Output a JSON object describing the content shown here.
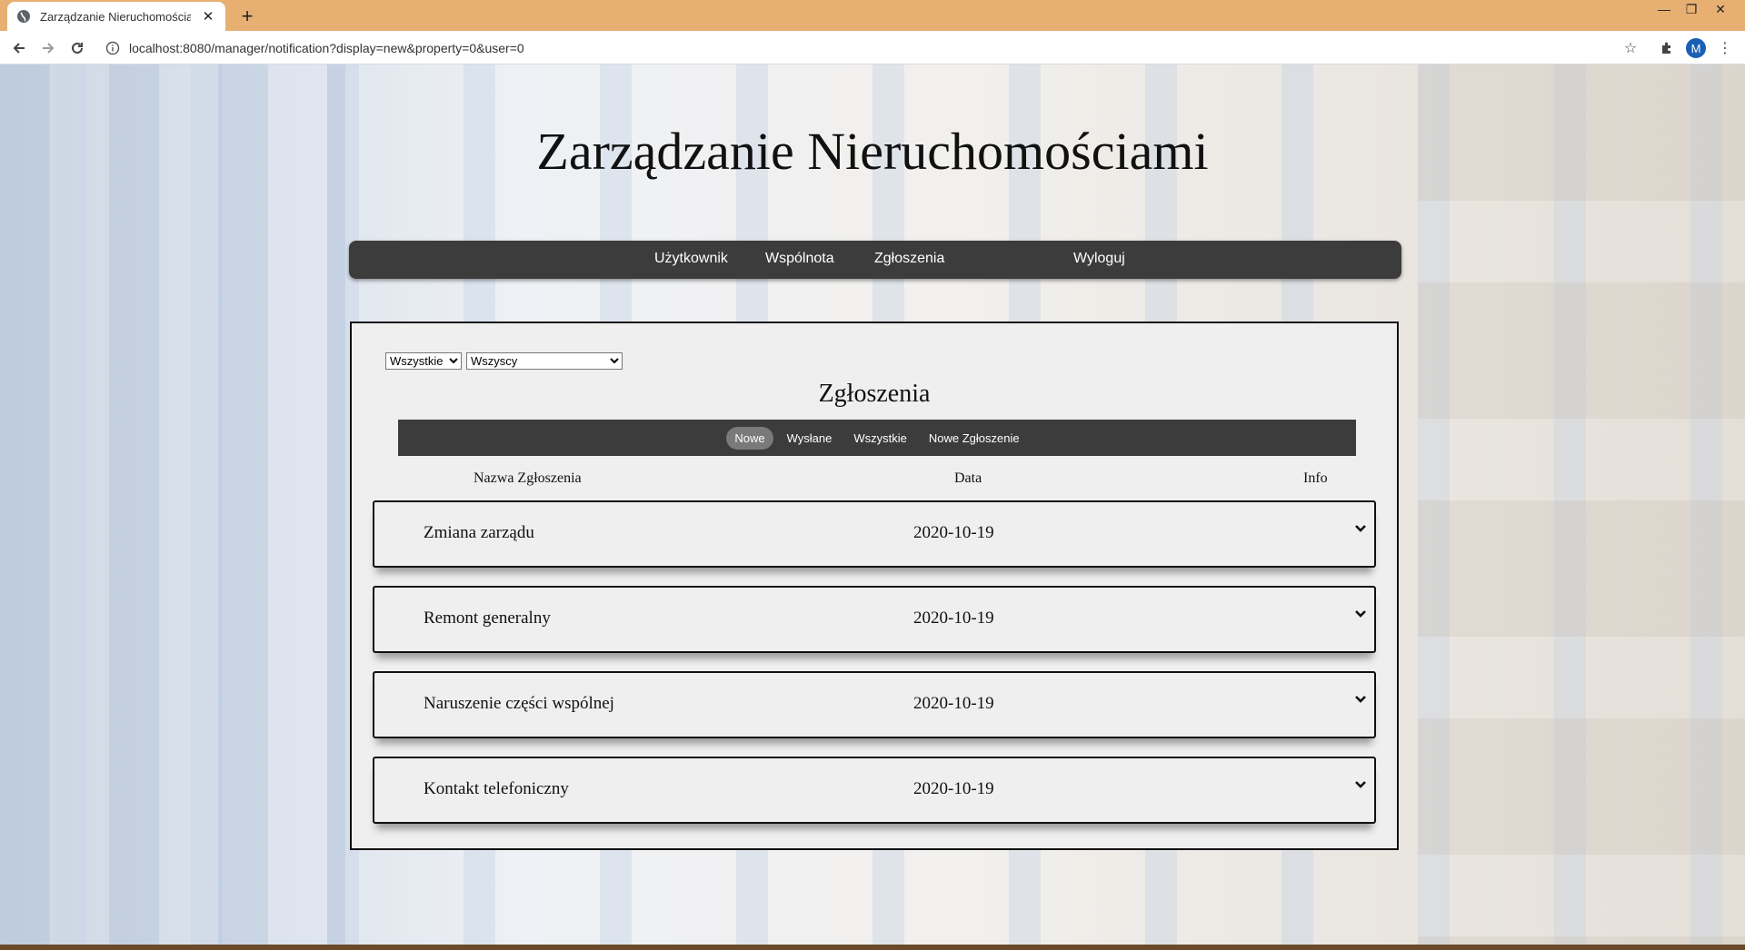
{
  "browser": {
    "tab_title": "Zarządzanie Nieruchomościami",
    "url": "localhost:8080/manager/notification?display=new&property=0&user=0",
    "profile_initial": "M"
  },
  "site": {
    "title": "Zarządzanie Nieruchomościami"
  },
  "topnav": {
    "items": [
      "Użytkownik",
      "Wspólnota",
      "Zgłoszenia",
      "Wyloguj"
    ]
  },
  "filters": {
    "property_select": "Wszystkie",
    "user_select": "Wszyscy"
  },
  "panel": {
    "title": "Zgłoszenia",
    "subnav": [
      "Nowe",
      "Wysłane",
      "Wszystkie",
      "Nowe Zgłoszenie"
    ],
    "active_subnav": "Nowe",
    "columns": [
      "Nazwa Zgłoszenia",
      "Data",
      "Info"
    ]
  },
  "notifications": [
    {
      "name": "Zmiana zarządu",
      "date": "2020-10-19"
    },
    {
      "name": "Remont generalny",
      "date": "2020-10-19"
    },
    {
      "name": "Naruszenie części wspólnej",
      "date": "2020-10-19"
    },
    {
      "name": "Kontakt telefoniczny",
      "date": "2020-10-19"
    }
  ]
}
